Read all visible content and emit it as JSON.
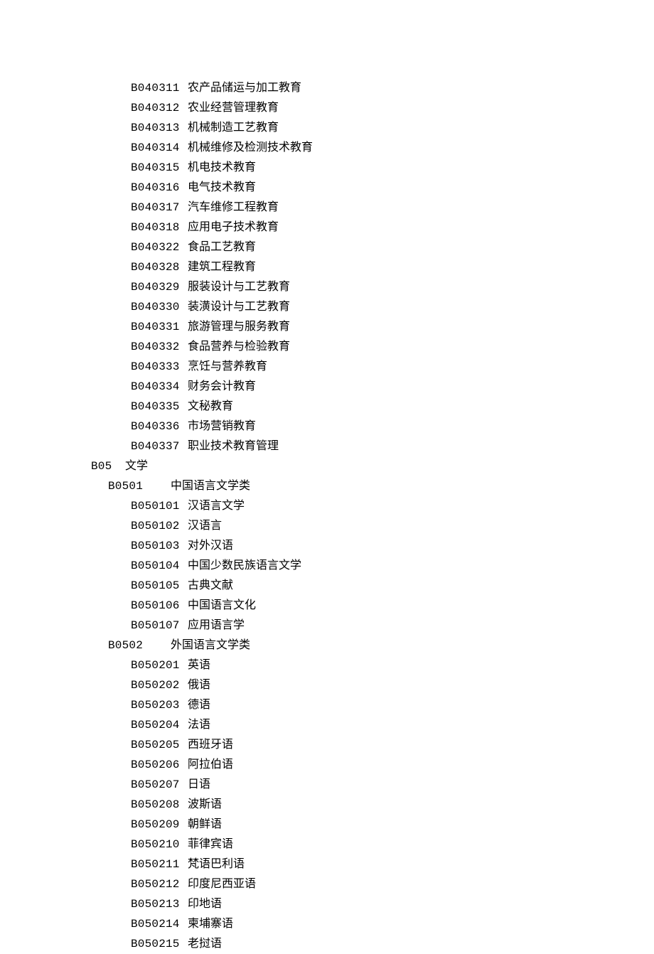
{
  "rows": [
    {
      "level": 3,
      "code": "B040311",
      "name": "农产品储运与加工教育"
    },
    {
      "level": 3,
      "code": "B040312",
      "name": "农业经营管理教育"
    },
    {
      "level": 3,
      "code": "B040313",
      "name": "机械制造工艺教育"
    },
    {
      "level": 3,
      "code": "B040314",
      "name": "机械维修及检测技术教育"
    },
    {
      "level": 3,
      "code": "B040315",
      "name": "机电技术教育"
    },
    {
      "level": 3,
      "code": "B040316",
      "name": "电气技术教育"
    },
    {
      "level": 3,
      "code": "B040317",
      "name": "汽车维修工程教育"
    },
    {
      "level": 3,
      "code": "B040318",
      "name": "应用电子技术教育"
    },
    {
      "level": 3,
      "code": "B040322",
      "name": "食品工艺教育"
    },
    {
      "level": 3,
      "code": "B040328",
      "name": "建筑工程教育"
    },
    {
      "level": 3,
      "code": "B040329",
      "name": "服装设计与工艺教育"
    },
    {
      "level": 3,
      "code": "B040330",
      "name": "装潢设计与工艺教育"
    },
    {
      "level": 3,
      "code": "B040331",
      "name": "旅游管理与服务教育"
    },
    {
      "level": 3,
      "code": "B040332",
      "name": "食品营养与检验教育"
    },
    {
      "level": 3,
      "code": "B040333",
      "name": "烹饪与营养教育"
    },
    {
      "level": 3,
      "code": "B040334",
      "name": "财务会计教育"
    },
    {
      "level": 3,
      "code": "B040335",
      "name": "文秘教育"
    },
    {
      "level": 3,
      "code": "B040336",
      "name": "市场营销教育"
    },
    {
      "level": 3,
      "code": "B040337",
      "name": "职业技术教育管理"
    },
    {
      "level": 1,
      "code": "B05",
      "name": "文学"
    },
    {
      "level": 2,
      "code": "B0501",
      "name": "中国语言文学类"
    },
    {
      "level": 3,
      "code": "B050101",
      "name": "汉语言文学"
    },
    {
      "level": 3,
      "code": "B050102",
      "name": "汉语言"
    },
    {
      "level": 3,
      "code": "B050103",
      "name": "对外汉语"
    },
    {
      "level": 3,
      "code": "B050104",
      "name": "中国少数民族语言文学"
    },
    {
      "level": 3,
      "code": "B050105",
      "name": "古典文献"
    },
    {
      "level": 3,
      "code": "B050106",
      "name": "中国语言文化"
    },
    {
      "level": 3,
      "code": "B050107",
      "name": "应用语言学"
    },
    {
      "level": 2,
      "code": "B0502",
      "name": "外国语言文学类"
    },
    {
      "level": 3,
      "code": "B050201",
      "name": "英语"
    },
    {
      "level": 3,
      "code": "B050202",
      "name": "俄语"
    },
    {
      "level": 3,
      "code": "B050203",
      "name": "德语"
    },
    {
      "level": 3,
      "code": "B050204",
      "name": "法语"
    },
    {
      "level": 3,
      "code": "B050205",
      "name": "西班牙语"
    },
    {
      "level": 3,
      "code": "B050206",
      "name": "阿拉伯语"
    },
    {
      "level": 3,
      "code": "B050207",
      "name": "日语"
    },
    {
      "level": 3,
      "code": "B050208",
      "name": "波斯语"
    },
    {
      "level": 3,
      "code": "B050209",
      "name": "朝鲜语"
    },
    {
      "level": 3,
      "code": "B050210",
      "name": "菲律宾语"
    },
    {
      "level": 3,
      "code": "B050211",
      "name": "梵语巴利语"
    },
    {
      "level": 3,
      "code": "B050212",
      "name": "印度尼西亚语"
    },
    {
      "level": 3,
      "code": "B050213",
      "name": "印地语"
    },
    {
      "level": 3,
      "code": "B050214",
      "name": "柬埔寨语"
    },
    {
      "level": 3,
      "code": "B050215",
      "name": "老挝语"
    }
  ]
}
